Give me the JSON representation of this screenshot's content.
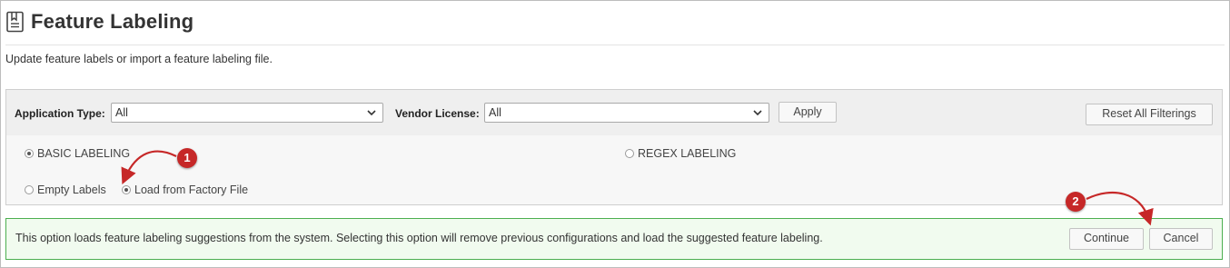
{
  "page": {
    "title": "Feature Labeling",
    "subtitle": "Update feature labels or import a feature labeling file.",
    "title_icon": "document-bookmark-icon"
  },
  "filters": {
    "application_type_label": "Application Type:",
    "application_type_value": "All",
    "vendor_license_label": "Vendor License:",
    "vendor_license_value": "All",
    "apply_label": "Apply",
    "reset_label": "Reset All Filterings"
  },
  "labeling_mode": {
    "selected": "basic",
    "options": [
      {
        "id": "basic",
        "label": "BASIC LABELING",
        "checked": true
      },
      {
        "id": "regex",
        "label": "REGEX LABELING",
        "checked": false
      }
    ]
  },
  "source": {
    "selected": "factory",
    "options": [
      {
        "id": "empty",
        "label": "Empty Labels",
        "checked": false
      },
      {
        "id": "factory",
        "label": "Load from Factory File",
        "checked": true
      }
    ]
  },
  "info": {
    "message": "This option loads feature labeling suggestions from the system. Selecting this option will remove previous configurations and load the suggested feature labeling.",
    "continue_label": "Continue",
    "cancel_label": "Cancel"
  },
  "annotations": [
    {
      "number": "1"
    },
    {
      "number": "2"
    }
  ],
  "colors": {
    "badge": "#c62828",
    "info_border": "#4caf50",
    "info_background": "#f1fbef"
  }
}
